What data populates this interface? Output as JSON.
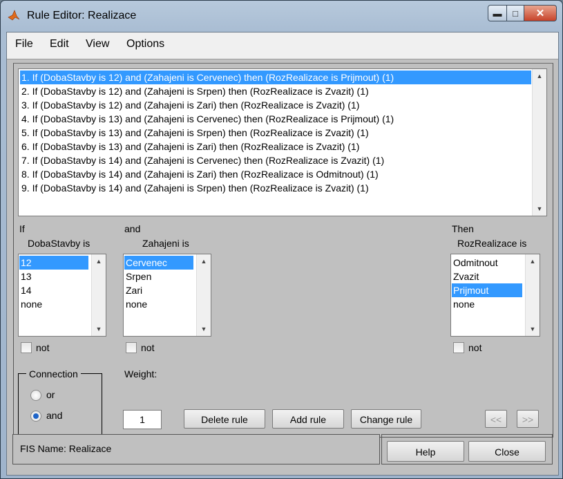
{
  "window": {
    "title": "Rule Editor: Realizace"
  },
  "menu": [
    "File",
    "Edit",
    "View",
    "Options"
  ],
  "rules": [
    "1. If (DobaStavby is 12) and (Zahajeni is Cervenec) then (RozRealizace is Prijmout) (1)",
    "2. If (DobaStavby is 12) and (Zahajeni is Srpen) then (RozRealizace is Zvazit) (1)",
    "3. If (DobaStavby is 12) and (Zahajeni is Zari) then (RozRealizace is Zvazit) (1)",
    "4. If (DobaStavby is 13) and (Zahajeni is Cervenec) then (RozRealizace is Prijmout) (1)",
    "5. If (DobaStavby is 13) and (Zahajeni is Srpen) then (RozRealizace is Zvazit) (1)",
    "6. If (DobaStavby is 13) and (Zahajeni is Zari) then (RozRealizace is Zvazit) (1)",
    "7. If (DobaStavby is 14) and (Zahajeni is Cervenec) then (RozRealizace is Zvazit) (1)",
    "8. If (DobaStavby is 14) and (Zahajeni is Zari) then (RozRealizace is Odmitnout) (1)",
    "9. If (DobaStavby is 14) and (Zahajeni is Srpen) then (RozRealizace is Zvazit) (1)"
  ],
  "selected_rule_index": 0,
  "input1": {
    "keyword": "If",
    "variable": "DobaStavby is",
    "options": [
      "12",
      "13",
      "14",
      "none"
    ],
    "selected": 0,
    "not_label": "not"
  },
  "input2": {
    "keyword": "and",
    "variable": "Zahajeni is",
    "options": [
      "Cervenec",
      "Srpen",
      "Zari",
      "none"
    ],
    "selected": 0,
    "not_label": "not"
  },
  "output": {
    "keyword": "Then",
    "variable": "RozRealizace is",
    "options": [
      "Odmitnout",
      "Zvazit",
      "Prijmout",
      "none"
    ],
    "selected": 2,
    "not_label": "not"
  },
  "connection": {
    "title": "Connection",
    "options": [
      "or",
      "and"
    ],
    "selected": "and"
  },
  "weight": {
    "label": "Weight:",
    "value": "1"
  },
  "buttons": {
    "delete": "Delete rule",
    "add": "Add rule",
    "change": "Change rule",
    "prev": "<<",
    "next": ">>",
    "help": "Help",
    "close": "Close"
  },
  "status": "FIS Name: Realizace",
  "colors": {
    "selection": "#3399ff",
    "panel": "#c0c0c0",
    "titlebar": "#a9bdd3",
    "close_button": "#c7432a"
  },
  "icons": {
    "app": "matlab-logo-icon",
    "scroll_up": "scroll-up-arrow-icon",
    "scroll_down": "scroll-down-arrow-icon"
  }
}
